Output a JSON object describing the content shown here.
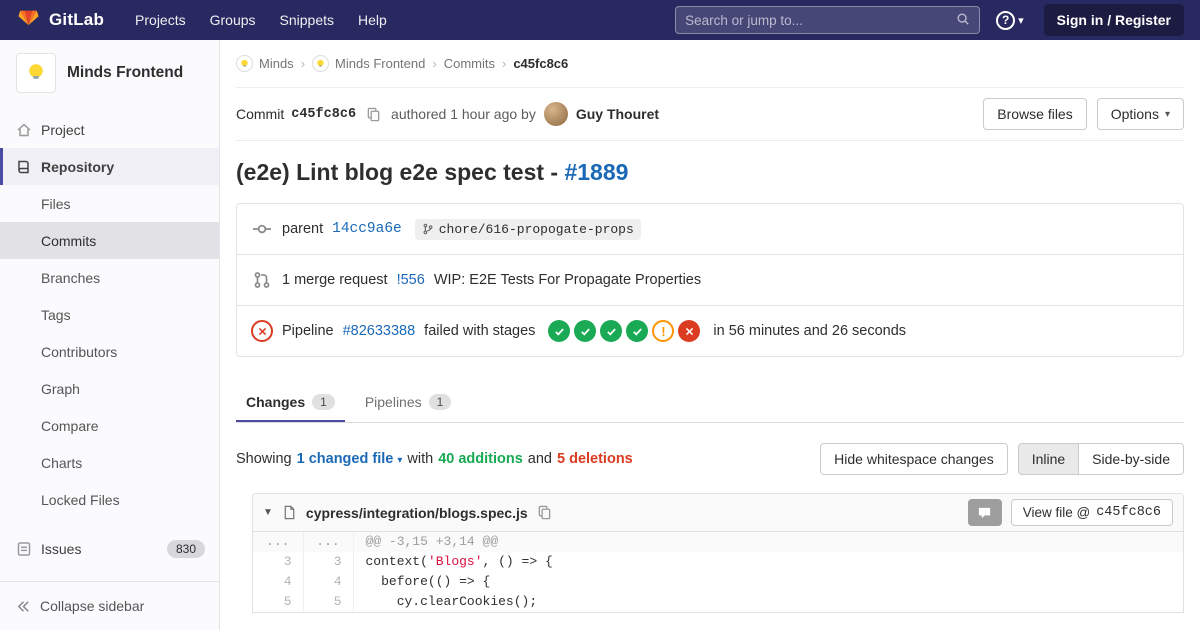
{
  "colors": {
    "navbar_bg": "#292961",
    "link_blue": "#1b69b6",
    "success_green": "#1aaa55",
    "warning_orange": "#fc9403",
    "danger_red": "#db3b21",
    "active_tab_underline": "#4b4ba3"
  },
  "icons": {
    "chevron_down": "▾",
    "breadcrumb_separator": "›",
    "collapse_caret": "▼",
    "warning_glyph": "!"
  },
  "navbar": {
    "brand": "GitLab",
    "links": [
      "Projects",
      "Groups",
      "Snippets",
      "Help"
    ],
    "search_placeholder": "Search or jump to...",
    "help_glyph": "?",
    "signin": "Sign in / Register"
  },
  "sidebar": {
    "project_name": "Minds Frontend",
    "project": "Project",
    "repository": "Repository",
    "repo_items": [
      "Files",
      "Commits",
      "Branches",
      "Tags",
      "Contributors",
      "Graph",
      "Compare",
      "Charts",
      "Locked Files"
    ],
    "issues": "Issues",
    "issues_count": "830",
    "collapse": "Collapse sidebar"
  },
  "breadcrumb": {
    "minds": "Minds",
    "minds_frontend": "Minds Frontend",
    "commits": "Commits",
    "sha": "c45fc8c6"
  },
  "commit": {
    "label": "Commit",
    "sha": "c45fc8c6",
    "authored": "authored 1 hour ago by",
    "author": "Guy Thouret",
    "browse_files": "Browse files",
    "options": "Options",
    "title": "(e2e) Lint blog e2e spec test - ",
    "issue_link": "#1889"
  },
  "details": {
    "parent_label": "parent",
    "parent_sha": "14cc9a6e",
    "branch_ref": "chore/616-propogate-props",
    "mr_count": "1 merge request",
    "mr_ref": "!556",
    "mr_title": "WIP: E2E Tests For Propagate Properties",
    "pipeline_label": "Pipeline",
    "pipeline_id": "#82633388",
    "pipeline_status": "failed with stages",
    "stages": [
      "success",
      "success",
      "success",
      "success",
      "warning",
      "failed"
    ],
    "pipeline_duration": "in 56 minutes and 26 seconds"
  },
  "tabs": {
    "changes": "Changes",
    "changes_count": "1",
    "pipelines": "Pipelines",
    "pipelines_count": "1"
  },
  "toolbar": {
    "showing": "Showing",
    "changed_file": "1 changed file",
    "with": "with",
    "additions": "40 additions",
    "and": "and",
    "deletions": "5 deletions",
    "hide_whitespace": "Hide whitespace changes",
    "inline": "Inline",
    "side_by_side": "Side-by-side"
  },
  "file": {
    "path": "cypress/integration/blogs.spec.js",
    "view_file": "View file @",
    "view_sha": "c45fc8c6"
  },
  "diff": {
    "hunk": {
      "old": "...",
      "new": "...",
      "text": "@@ -3,15 +3,14 @@"
    },
    "lines": [
      {
        "old": "3",
        "new": "3",
        "pre": "context(",
        "str": "'Blogs'",
        "post": ", () => {"
      },
      {
        "old": "4",
        "new": "4",
        "pre": "  before(() => {",
        "str": "",
        "post": ""
      },
      {
        "old": "5",
        "new": "5",
        "pre": "    cy.clearCookies();",
        "str": "",
        "post": ""
      }
    ]
  }
}
